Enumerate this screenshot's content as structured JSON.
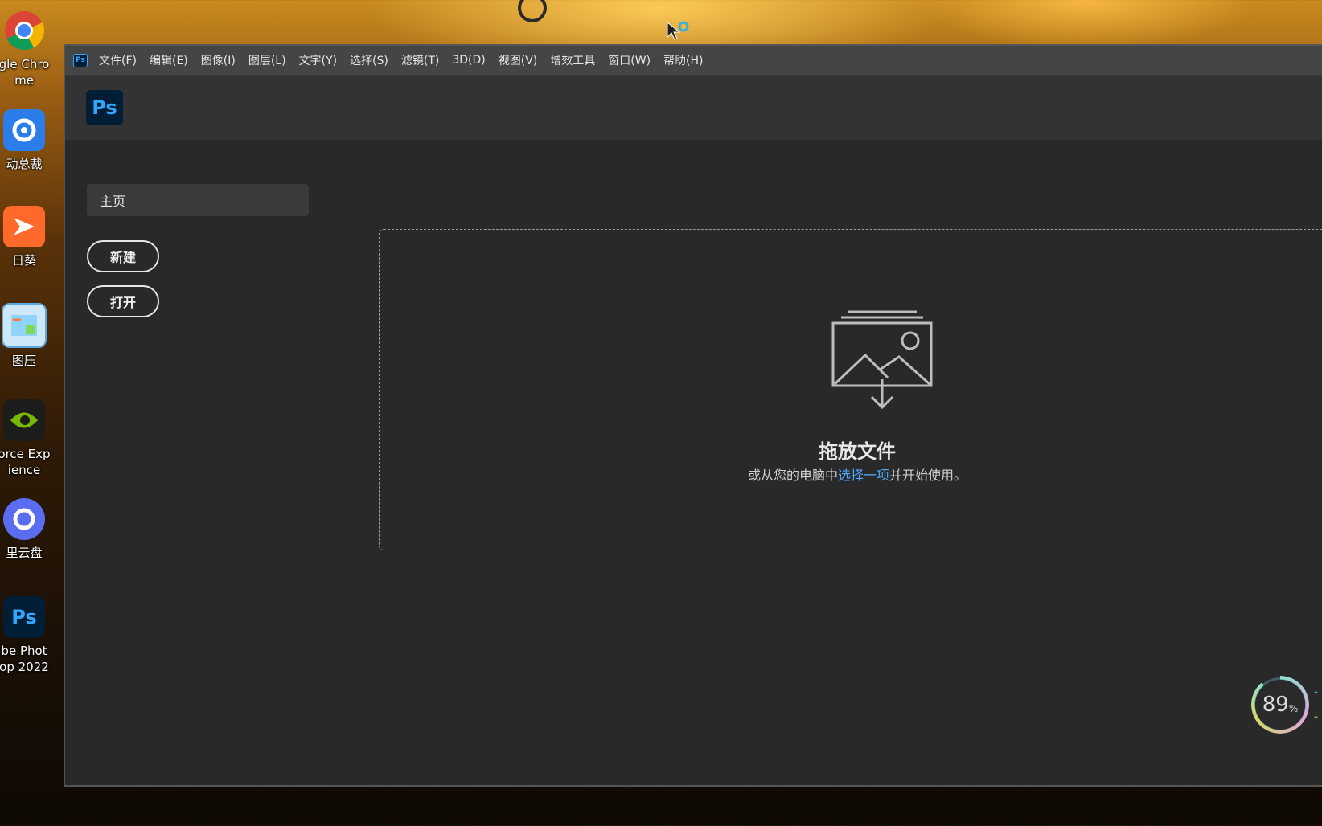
{
  "desktop": {
    "icons": [
      {
        "label_line1": "gle Chro",
        "label_line2": "me",
        "icon": "chrome-icon"
      },
      {
        "label_line1": "动总裁",
        "label_line2": "",
        "icon": "driver-tool-icon"
      },
      {
        "label_line1": "日葵",
        "label_line2": "",
        "icon": "sunflower-remote-icon"
      },
      {
        "label_line1": "图压",
        "label_line2": "",
        "icon": "image-compress-icon"
      },
      {
        "label_line1": "orce Exp",
        "label_line2": "ience",
        "icon": "geforce-experience-icon"
      },
      {
        "label_line1": "里云盘",
        "label_line2": "",
        "icon": "aliyun-drive-icon"
      },
      {
        "label_line1": "be Phot",
        "label_line2": "op 2022",
        "icon": "photoshop-icon"
      }
    ]
  },
  "window": {
    "app_badge": "Ps",
    "menu": [
      "文件(F)",
      "编辑(E)",
      "图像(I)",
      "图层(L)",
      "文字(Y)",
      "选择(S)",
      "滤镜(T)",
      "3D(D)",
      "视图(V)",
      "增效工具",
      "窗口(W)",
      "帮助(H)"
    ],
    "logo": "Ps",
    "sidebar": {
      "home_tab": "主页",
      "new_button": "新建",
      "open_button": "打开"
    },
    "dropzone": {
      "title": "拖放文件",
      "sub_before": "或从您的电脑中",
      "sub_link": "选择一项",
      "sub_after": "并开始使用。"
    }
  },
  "system": {
    "gauge_value": "89",
    "gauge_unit": "%"
  },
  "colors": {
    "accent": "#31a8ff",
    "link": "#4ea6ff",
    "window_bg": "#292929"
  }
}
